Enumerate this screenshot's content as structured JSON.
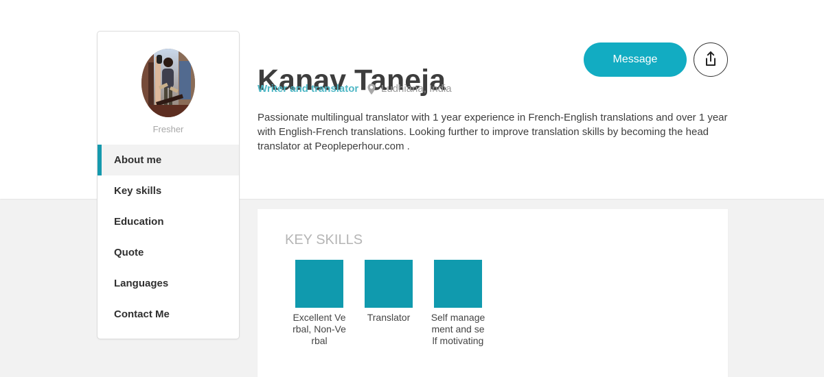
{
  "profile": {
    "name": "Kanav Taneja",
    "role": "Writer and translator",
    "location": "Ludhiana, India",
    "bio": "Passionate multilingual translator with 1 year experience in French-English translations and over 1 year with English-French translations. Looking further to improve translation skills by becoming the head translator at Peopleperhour.com .",
    "status": "Fresher"
  },
  "actions": {
    "message_label": "Message",
    "share_icon": "share-upload-icon"
  },
  "sidebar": {
    "items": [
      {
        "label": "About me",
        "active": true
      },
      {
        "label": "Key skills",
        "active": false
      },
      {
        "label": "Education",
        "active": false
      },
      {
        "label": "Quote",
        "active": false
      },
      {
        "label": "Languages",
        "active": false
      },
      {
        "label": "Contact Me",
        "active": false
      }
    ]
  },
  "skills": {
    "heading": "KEY SKILLS",
    "items": [
      {
        "label": "Excellent Verbal, Non-Verbal"
      },
      {
        "label": "Translator"
      },
      {
        "label": "Self management and self motivating"
      }
    ]
  },
  "colors": {
    "accent": "#12acc2",
    "skill_tile": "#109aae",
    "role_text": "#4eb7c5",
    "background": "#f2f2f2"
  },
  "icons": {
    "location": "map-pin-icon",
    "share": "share-upload-icon",
    "avatar": "profile-photo"
  }
}
